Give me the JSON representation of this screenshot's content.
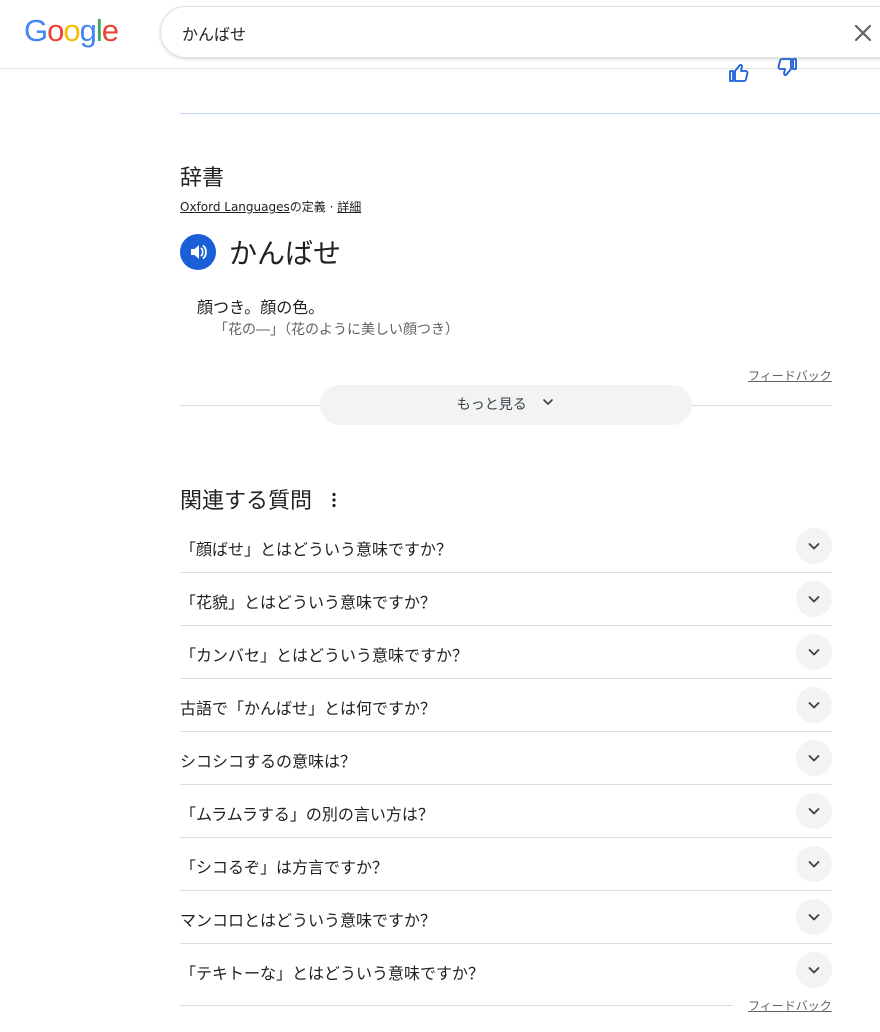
{
  "header": {
    "logo_letters": [
      {
        "ch": "G",
        "color": "#4285F4"
      },
      {
        "ch": "o",
        "color": "#EA4335"
      },
      {
        "ch": "o",
        "color": "#FBBC05"
      },
      {
        "ch": "g",
        "color": "#4285F4"
      },
      {
        "ch": "l",
        "color": "#34A853"
      },
      {
        "ch": "e",
        "color": "#EA4335"
      }
    ],
    "search_query": "かんばせ",
    "clear_icon": "close-icon"
  },
  "dictionary": {
    "section_title": "辞書",
    "source_name": "Oxford Languages",
    "source_suffix": "の定義",
    "separator": " · ",
    "details_link": "詳細",
    "headword": "かんばせ",
    "definition": "顔つき。顔の色。",
    "example": "「花の―」（花のように美しい顔つき）",
    "feedback": "フィードバック",
    "more_button": "もっと見る"
  },
  "related_questions": {
    "title": "関連する質問",
    "questions": [
      "「顔ばせ」とはどういう意味ですか？",
      "「花貌」とはどういう意味ですか？",
      "「カンバセ」とはどういう意味ですか？",
      "古語で「かんばせ」とは何ですか？",
      "シコシコするの意味は？",
      "「ムラムラする」の別の言い方は？",
      "「シコるぞ」は方言ですか？",
      "マンコロとはどういう意味ですか？",
      "「テキトーな」とはどういう意味ですか？"
    ],
    "feedback": "フィードバック"
  },
  "colors": {
    "accent_blue": "#1a5ed8",
    "chip_bg": "#f1f3f4",
    "divider": "#dadce0"
  }
}
